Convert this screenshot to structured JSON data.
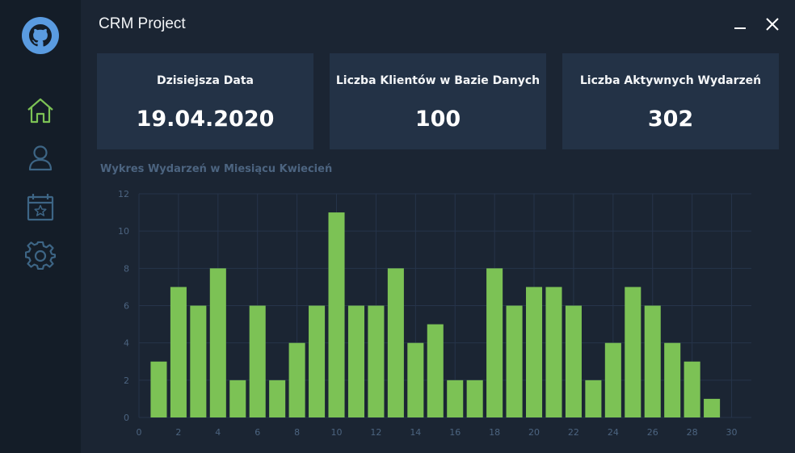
{
  "window": {
    "title": "CRM Project"
  },
  "sidebar": {
    "items": [
      {
        "name": "home",
        "icon": "home-icon",
        "active": true
      },
      {
        "name": "clients",
        "icon": "user-icon",
        "active": false
      },
      {
        "name": "calendar",
        "icon": "calendar-star-icon",
        "active": false
      },
      {
        "name": "settings",
        "icon": "gear-icon",
        "active": false
      }
    ]
  },
  "cards": [
    {
      "label": "Dzisiejsza Data",
      "value": "19.04.2020"
    },
    {
      "label": "Liczba Klientów w Bazie Danych",
      "value": "100"
    },
    {
      "label": "Liczba Aktywnych Wydarzeń",
      "value": "302"
    }
  ],
  "colors": {
    "background": "#1b2533",
    "sidebar": "#141d28",
    "card": "#233246",
    "accent": "#7cc255",
    "icon_muted": "#3d6585"
  },
  "chart_data": {
    "type": "bar",
    "title": "Wykres Wydarzeń w Miesiącu Kwiecień",
    "x": [
      1,
      2,
      3,
      4,
      5,
      6,
      7,
      8,
      9,
      10,
      11,
      12,
      13,
      14,
      15,
      16,
      17,
      18,
      19,
      20,
      21,
      22,
      23,
      24,
      25,
      26,
      27,
      28,
      29
    ],
    "values": [
      3,
      7,
      6,
      8,
      2,
      6,
      2,
      4,
      6,
      11,
      6,
      6,
      8,
      4,
      5,
      2,
      2,
      8,
      6,
      7,
      7,
      6,
      2,
      4,
      7,
      6,
      4,
      3,
      1
    ],
    "xlim": [
      0,
      31
    ],
    "ylim": [
      0,
      12
    ],
    "xticks": [
      0,
      2,
      4,
      6,
      8,
      10,
      12,
      14,
      16,
      18,
      20,
      22,
      24,
      26,
      28,
      30
    ],
    "yticks": [
      0,
      2,
      4,
      6,
      8,
      10,
      12
    ],
    "grid": true,
    "color": "#7cc255"
  }
}
